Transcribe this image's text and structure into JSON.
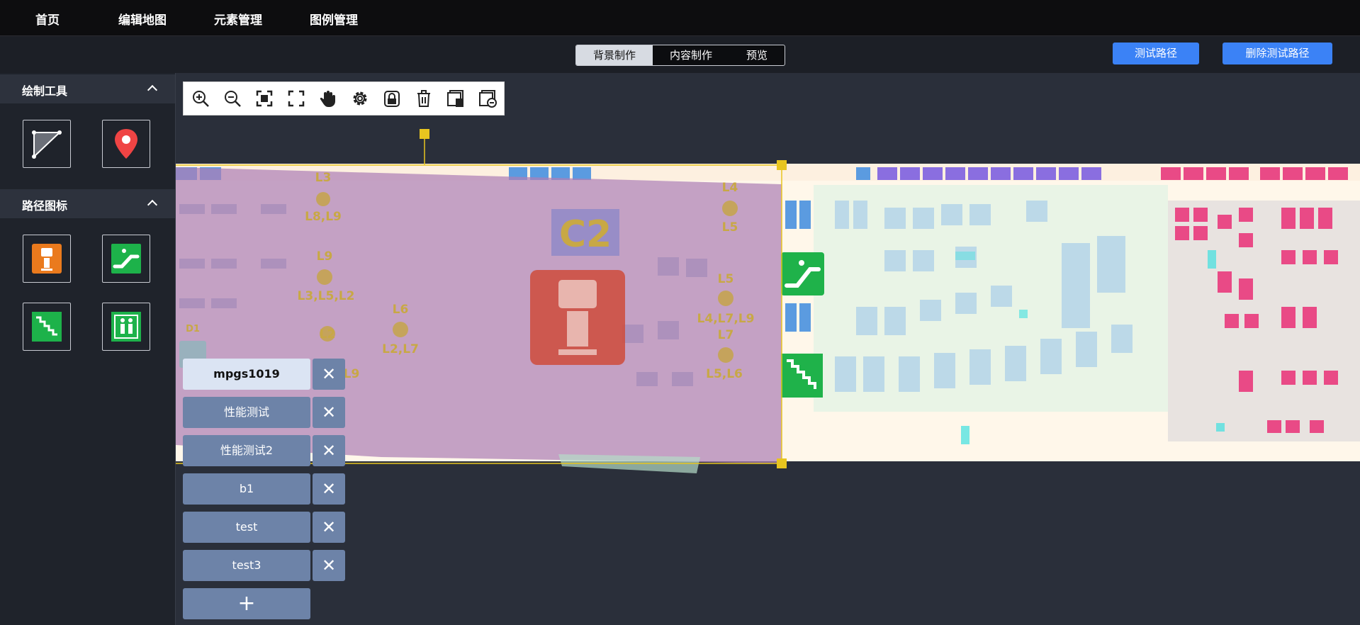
{
  "nav": {
    "items": [
      {
        "label": "首页"
      },
      {
        "label": "编辑地图"
      },
      {
        "label": "元素管理"
      },
      {
        "label": "图例管理"
      }
    ]
  },
  "mode_tabs": {
    "background": "背景制作",
    "content": "内容制作",
    "preview": "预览",
    "active": "background"
  },
  "actions": {
    "test_route": "测试路径",
    "delete_test_route": "删除测试路径"
  },
  "sidebar": {
    "draw_tools": {
      "title": "绘制工具",
      "tools": [
        {
          "icon": "polygon-draw-icon"
        },
        {
          "icon": "location-pin-icon"
        }
      ]
    },
    "route_icons": {
      "title": "路径图标",
      "icons": [
        {
          "icon": "kiosk-icon"
        },
        {
          "icon": "escalator-icon"
        },
        {
          "icon": "stairs-icon"
        },
        {
          "icon": "elevator-icon"
        }
      ]
    }
  },
  "toolbar": {
    "tools": [
      {
        "icon": "zoom-in-icon"
      },
      {
        "icon": "zoom-out-icon"
      },
      {
        "icon": "fit-screen-icon"
      },
      {
        "icon": "fullscreen-icon"
      },
      {
        "icon": "pan-hand-icon"
      },
      {
        "icon": "settings-gear-icon"
      },
      {
        "icon": "lock-icon"
      },
      {
        "icon": "delete-trash-icon"
      },
      {
        "icon": "delete-layer-icon"
      },
      {
        "icon": "remove-layer-icon"
      }
    ]
  },
  "layers": {
    "items": [
      {
        "label": "mpgs1019",
        "active": true
      },
      {
        "label": "性能测试",
        "active": false
      },
      {
        "label": "性能测试2",
        "active": false
      },
      {
        "label": "b1",
        "active": false
      },
      {
        "label": "test",
        "active": false
      },
      {
        "label": "test3",
        "active": false
      }
    ],
    "delete_symbol": "✕",
    "add_symbol": "+"
  },
  "map": {
    "zone_label": "C2",
    "side_marker": "D1",
    "overlay_labels": [
      "L3",
      "L8,L9",
      "L9",
      "L3,L5,L2",
      "L2",
      "L6",
      "L2,L7",
      "L9",
      "L4",
      "L5",
      "L5",
      "L4,L7,L9",
      "L7",
      "L5,L6"
    ],
    "colors": {
      "background": "#fff7ea",
      "overlay": "#ad7fb6",
      "selection": "#e8c51f",
      "escalator_sign": "#1fb24a",
      "kiosk": "#d24c30",
      "pink_shop": "#e94a86",
      "blue_shop": "#5b9be0",
      "purple_shop": "#8a6ee0"
    }
  }
}
